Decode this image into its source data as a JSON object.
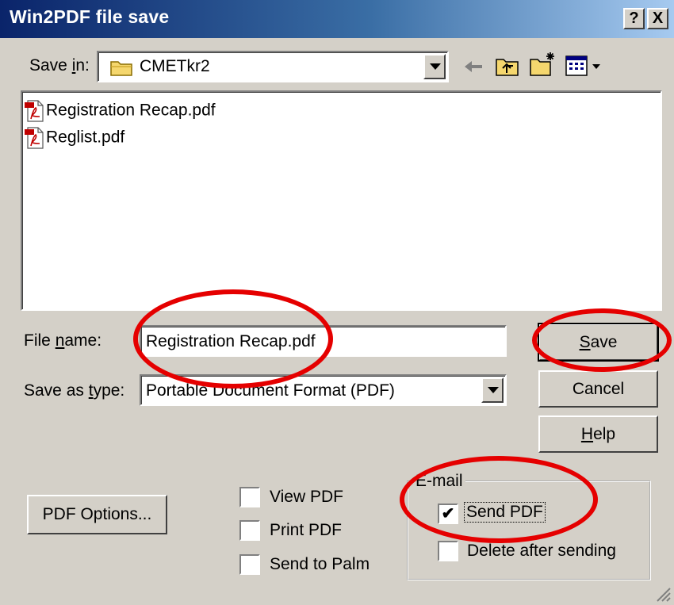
{
  "title": "Win2PDF file save",
  "titlebar_buttons": {
    "help": "?",
    "close": "X"
  },
  "save_in": {
    "label_pre": "Save ",
    "label_key": "i",
    "label_post": "n:",
    "value": "CMETkr2"
  },
  "toolbar_icons": [
    "back-arrow-icon",
    "up-folder-icon",
    "new-folder-icon",
    "view-menu-icon"
  ],
  "files": [
    "Registration Recap.pdf",
    "Reglist.pdf"
  ],
  "filename": {
    "label_pre": "File ",
    "label_key": "n",
    "label_post": "ame:",
    "value": "Registration Recap.pdf"
  },
  "filetype": {
    "label_pre": "Save as ",
    "label_key": "t",
    "label_post": "ype:",
    "value": "Portable Document Format (PDF)"
  },
  "buttons": {
    "save": {
      "key": "S",
      "rest": "ave"
    },
    "cancel": "Cancel",
    "help": {
      "key": "H",
      "rest": "elp"
    },
    "pdf_options": "PDF Options..."
  },
  "options": {
    "view_pdf": {
      "label": "View PDF",
      "checked": false
    },
    "print_pdf": {
      "label": "Print PDF",
      "checked": false
    },
    "send_palm": {
      "label": "Send to Palm",
      "checked": false
    }
  },
  "email": {
    "group_label": "E-mail",
    "send_pdf": {
      "label": "Send PDF",
      "checked": true,
      "mark": "✔"
    },
    "delete_after": {
      "label": "Delete after sending",
      "checked": false
    }
  },
  "colors": {
    "annotation": "#e50000",
    "titlebar_start": "#0a246a",
    "face": "#d4d0c8"
  }
}
